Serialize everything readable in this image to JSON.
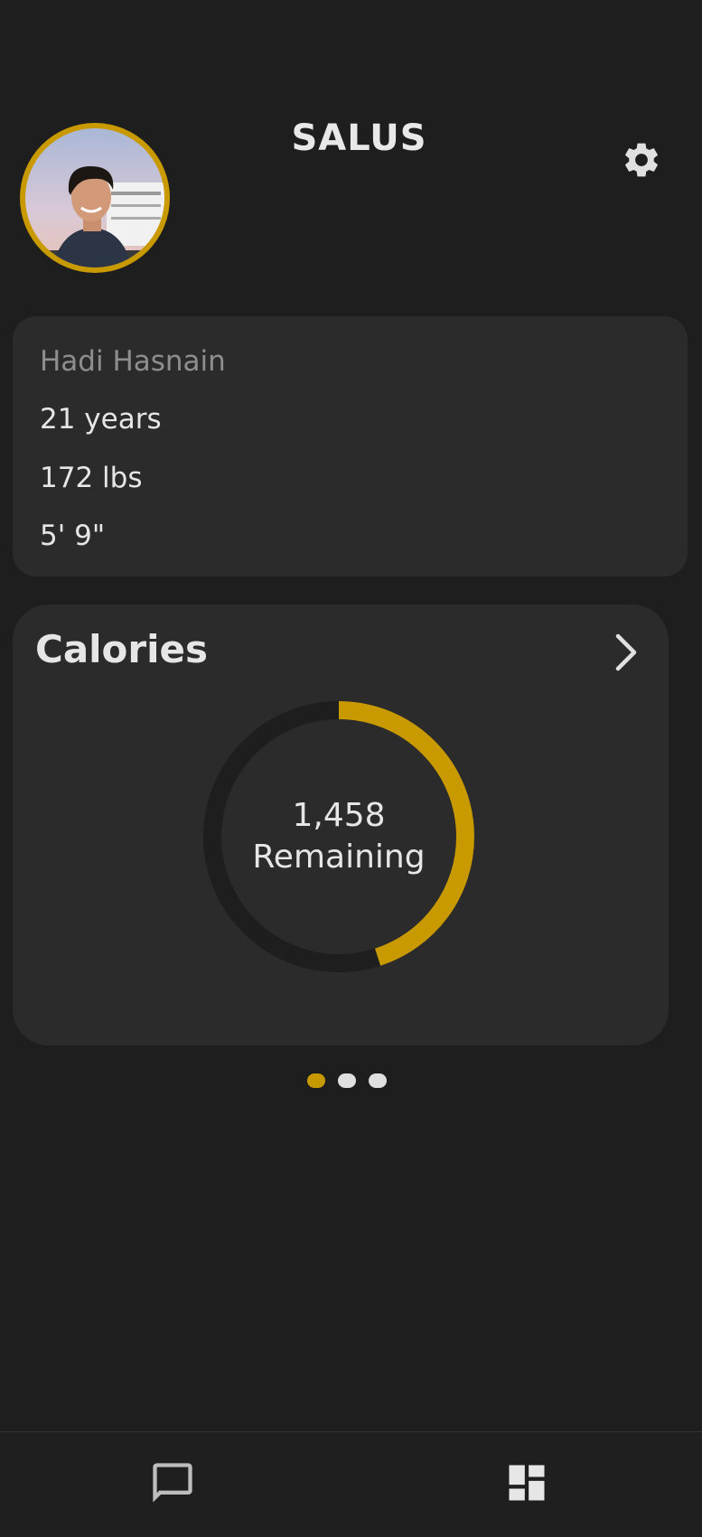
{
  "header": {
    "app_title": "SALUS",
    "avatar_icon": "profile-photo",
    "settings_icon": "gear-icon"
  },
  "profile": {
    "name": "Hadi Hasnain",
    "age": "21 years",
    "weight": "172 lbs",
    "height": "5' 9\""
  },
  "calories": {
    "title": "Calories",
    "remaining_value": "1,458",
    "remaining_label": "Remaining",
    "progress_fraction": 0.45,
    "accent_color": "#c99a00",
    "track_color": "#1e1e1e"
  },
  "pager": {
    "count": 3,
    "active_index": 0
  },
  "bottom_nav": {
    "items": [
      {
        "icon": "chat-bubble-icon",
        "active": false
      },
      {
        "icon": "dashboard-icon",
        "active": true
      }
    ]
  },
  "colors": {
    "background": "#1e1e1e",
    "card": "#2b2b2b",
    "accent": "#c99a00",
    "muted_text": "#8e8e8e"
  }
}
